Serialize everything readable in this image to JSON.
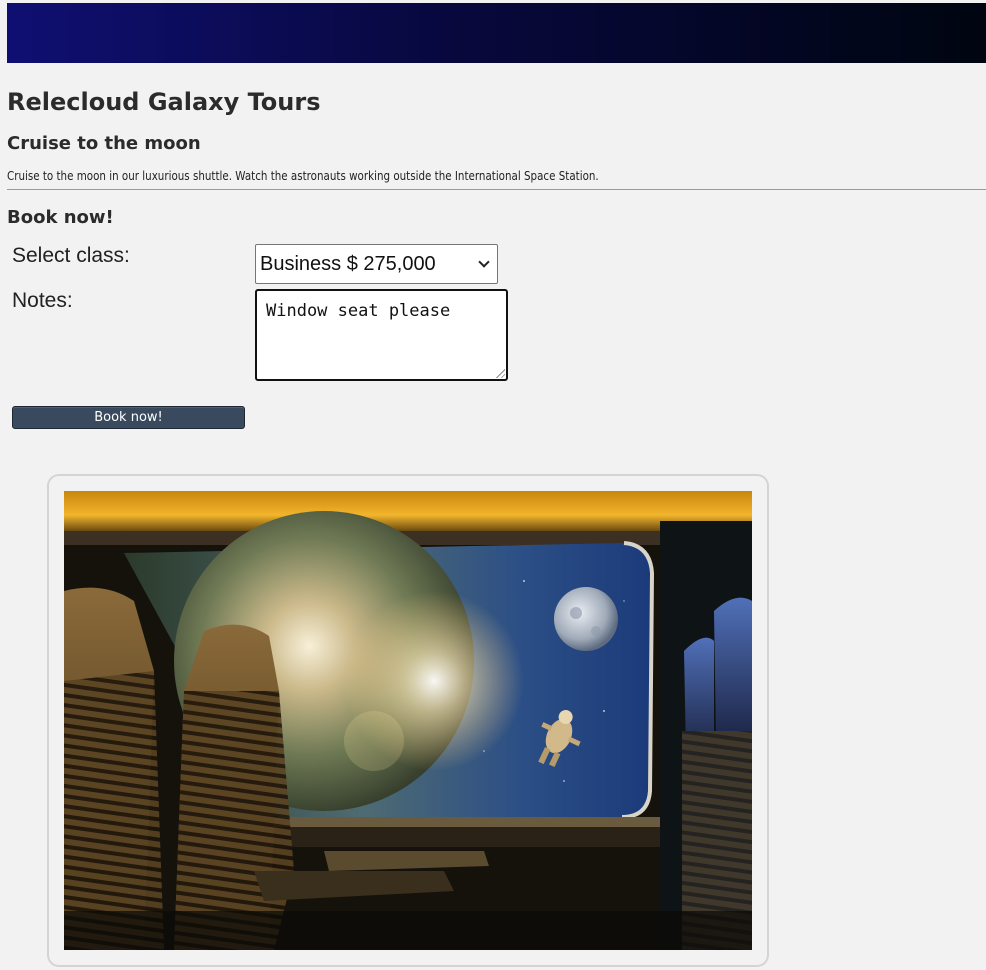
{
  "site": {
    "title": "Relecloud Galaxy Tours"
  },
  "tour": {
    "name": "Cruise to the moon",
    "description": "Cruise to the moon in our luxurious shuttle. Watch the astronauts working outside the International Space Station."
  },
  "booking": {
    "heading": "Book now!",
    "class_label": "Select class:",
    "class_selected": "Business $ 275,000",
    "notes_label": "Notes:",
    "notes_value": "Window seat please",
    "submit_label": "Book now!"
  },
  "theme": {
    "banner_start": "#0f0f72",
    "banner_end": "#000510",
    "button_color": "#3a4a5e",
    "page_background": "#f2f2f2"
  }
}
